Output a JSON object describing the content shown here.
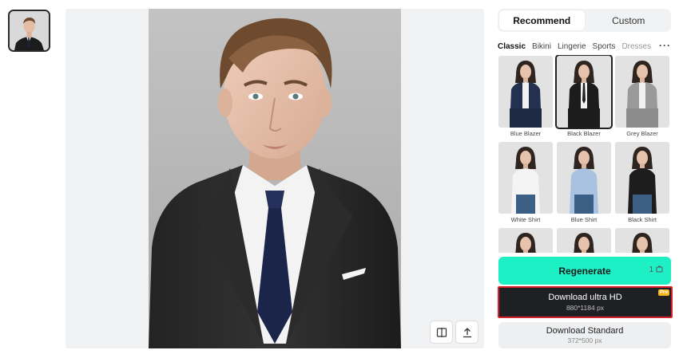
{
  "thumbnails": [
    {
      "name": "current-photo"
    }
  ],
  "toolbar": {
    "compare_icon": "compare-icon",
    "export_icon": "upload-icon"
  },
  "tabs": [
    {
      "label": "Recommend",
      "active": true
    },
    {
      "label": "Custom",
      "active": false
    }
  ],
  "categories": [
    {
      "label": "Classic",
      "active": true
    },
    {
      "label": "Bikini",
      "active": false
    },
    {
      "label": "Lingerie",
      "active": false
    },
    {
      "label": "Sports",
      "active": false
    },
    {
      "label": "Dresses",
      "active": false
    }
  ],
  "more_label": "···",
  "styles": [
    {
      "label": "Blue Blazer",
      "selected": false,
      "outfit": "blue-blazer"
    },
    {
      "label": "Black Blazer",
      "selected": true,
      "outfit": "black-blazer"
    },
    {
      "label": "Grey Blazer",
      "selected": false,
      "outfit": "grey-blazer"
    },
    {
      "label": "White Shirt",
      "selected": false,
      "outfit": "white-shirt"
    },
    {
      "label": "Blue Shirt",
      "selected": false,
      "outfit": "blue-shirt"
    },
    {
      "label": "Black Shirt",
      "selected": false,
      "outfit": "black-shirt"
    },
    {
      "label": "",
      "selected": false,
      "outfit": "partial"
    },
    {
      "label": "",
      "selected": false,
      "outfit": "partial"
    },
    {
      "label": "",
      "selected": false,
      "outfit": "partial"
    }
  ],
  "regenerate": {
    "label": "Regenerate",
    "count": "1"
  },
  "download_hd": {
    "label": "Download ultra HD",
    "size": "880*1184 px",
    "badge": "Pro"
  },
  "download_standard": {
    "label": "Download Standard",
    "size": "372*500 px"
  },
  "colors": {
    "accent": "#1ef0c6",
    "highlight": "#d8202a",
    "dark": "#1f2024"
  }
}
